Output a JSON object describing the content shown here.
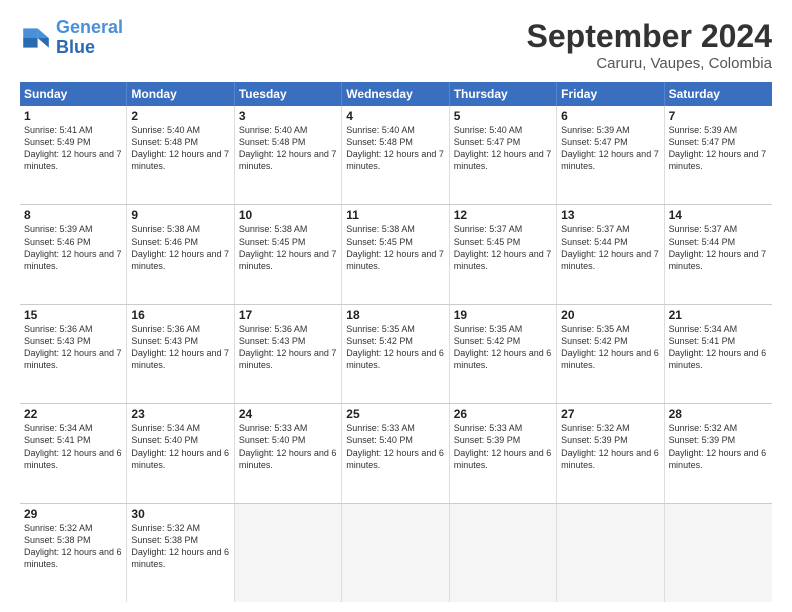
{
  "header": {
    "logo_line1": "General",
    "logo_line2": "Blue",
    "month": "September 2024",
    "location": "Caruru, Vaupes, Colombia"
  },
  "days_of_week": [
    "Sunday",
    "Monday",
    "Tuesday",
    "Wednesday",
    "Thursday",
    "Friday",
    "Saturday"
  ],
  "weeks": [
    [
      {
        "day": 1,
        "sunrise": "5:41 AM",
        "sunset": "5:49 PM",
        "daylight": "12 hours and 7 minutes."
      },
      {
        "day": 2,
        "sunrise": "5:40 AM",
        "sunset": "5:48 PM",
        "daylight": "12 hours and 7 minutes."
      },
      {
        "day": 3,
        "sunrise": "5:40 AM",
        "sunset": "5:48 PM",
        "daylight": "12 hours and 7 minutes."
      },
      {
        "day": 4,
        "sunrise": "5:40 AM",
        "sunset": "5:48 PM",
        "daylight": "12 hours and 7 minutes."
      },
      {
        "day": 5,
        "sunrise": "5:40 AM",
        "sunset": "5:47 PM",
        "daylight": "12 hours and 7 minutes."
      },
      {
        "day": 6,
        "sunrise": "5:39 AM",
        "sunset": "5:47 PM",
        "daylight": "12 hours and 7 minutes."
      },
      {
        "day": 7,
        "sunrise": "5:39 AM",
        "sunset": "5:47 PM",
        "daylight": "12 hours and 7 minutes."
      }
    ],
    [
      {
        "day": 8,
        "sunrise": "5:39 AM",
        "sunset": "5:46 PM",
        "daylight": "12 hours and 7 minutes."
      },
      {
        "day": 9,
        "sunrise": "5:38 AM",
        "sunset": "5:46 PM",
        "daylight": "12 hours and 7 minutes."
      },
      {
        "day": 10,
        "sunrise": "5:38 AM",
        "sunset": "5:45 PM",
        "daylight": "12 hours and 7 minutes."
      },
      {
        "day": 11,
        "sunrise": "5:38 AM",
        "sunset": "5:45 PM",
        "daylight": "12 hours and 7 minutes."
      },
      {
        "day": 12,
        "sunrise": "5:37 AM",
        "sunset": "5:45 PM",
        "daylight": "12 hours and 7 minutes."
      },
      {
        "day": 13,
        "sunrise": "5:37 AM",
        "sunset": "5:44 PM",
        "daylight": "12 hours and 7 minutes."
      },
      {
        "day": 14,
        "sunrise": "5:37 AM",
        "sunset": "5:44 PM",
        "daylight": "12 hours and 7 minutes."
      }
    ],
    [
      {
        "day": 15,
        "sunrise": "5:36 AM",
        "sunset": "5:43 PM",
        "daylight": "12 hours and 7 minutes."
      },
      {
        "day": 16,
        "sunrise": "5:36 AM",
        "sunset": "5:43 PM",
        "daylight": "12 hours and 7 minutes."
      },
      {
        "day": 17,
        "sunrise": "5:36 AM",
        "sunset": "5:43 PM",
        "daylight": "12 hours and 7 minutes."
      },
      {
        "day": 18,
        "sunrise": "5:35 AM",
        "sunset": "5:42 PM",
        "daylight": "12 hours and 6 minutes."
      },
      {
        "day": 19,
        "sunrise": "5:35 AM",
        "sunset": "5:42 PM",
        "daylight": "12 hours and 6 minutes."
      },
      {
        "day": 20,
        "sunrise": "5:35 AM",
        "sunset": "5:42 PM",
        "daylight": "12 hours and 6 minutes."
      },
      {
        "day": 21,
        "sunrise": "5:34 AM",
        "sunset": "5:41 PM",
        "daylight": "12 hours and 6 minutes."
      }
    ],
    [
      {
        "day": 22,
        "sunrise": "5:34 AM",
        "sunset": "5:41 PM",
        "daylight": "12 hours and 6 minutes."
      },
      {
        "day": 23,
        "sunrise": "5:34 AM",
        "sunset": "5:40 PM",
        "daylight": "12 hours and 6 minutes."
      },
      {
        "day": 24,
        "sunrise": "5:33 AM",
        "sunset": "5:40 PM",
        "daylight": "12 hours and 6 minutes."
      },
      {
        "day": 25,
        "sunrise": "5:33 AM",
        "sunset": "5:40 PM",
        "daylight": "12 hours and 6 minutes."
      },
      {
        "day": 26,
        "sunrise": "5:33 AM",
        "sunset": "5:39 PM",
        "daylight": "12 hours and 6 minutes."
      },
      {
        "day": 27,
        "sunrise": "5:32 AM",
        "sunset": "5:39 PM",
        "daylight": "12 hours and 6 minutes."
      },
      {
        "day": 28,
        "sunrise": "5:32 AM",
        "sunset": "5:39 PM",
        "daylight": "12 hours and 6 minutes."
      }
    ],
    [
      {
        "day": 29,
        "sunrise": "5:32 AM",
        "sunset": "5:38 PM",
        "daylight": "12 hours and 6 minutes."
      },
      {
        "day": 30,
        "sunrise": "5:32 AM",
        "sunset": "5:38 PM",
        "daylight": "12 hours and 6 minutes."
      },
      null,
      null,
      null,
      null,
      null
    ]
  ]
}
